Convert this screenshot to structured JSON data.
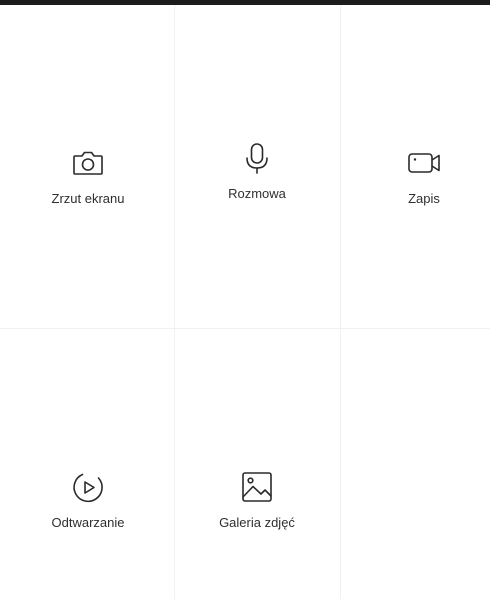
{
  "tiles": [
    {
      "label": "Zrzut ekranu",
      "icon": "camera-icon"
    },
    {
      "label": "Rozmowa",
      "icon": "microphone-icon"
    },
    {
      "label": "Zapis",
      "icon": "video-camera-icon"
    },
    {
      "label": "Odtwarzanie",
      "icon": "play-circle-icon"
    },
    {
      "label": "Galeria zdjęć",
      "icon": "image-icon"
    }
  ],
  "colors": {
    "top_bar": "#1c1c1c",
    "divider": "#f1f1f1",
    "icon": "#2a2a2a",
    "text": "#2f2f2f"
  }
}
